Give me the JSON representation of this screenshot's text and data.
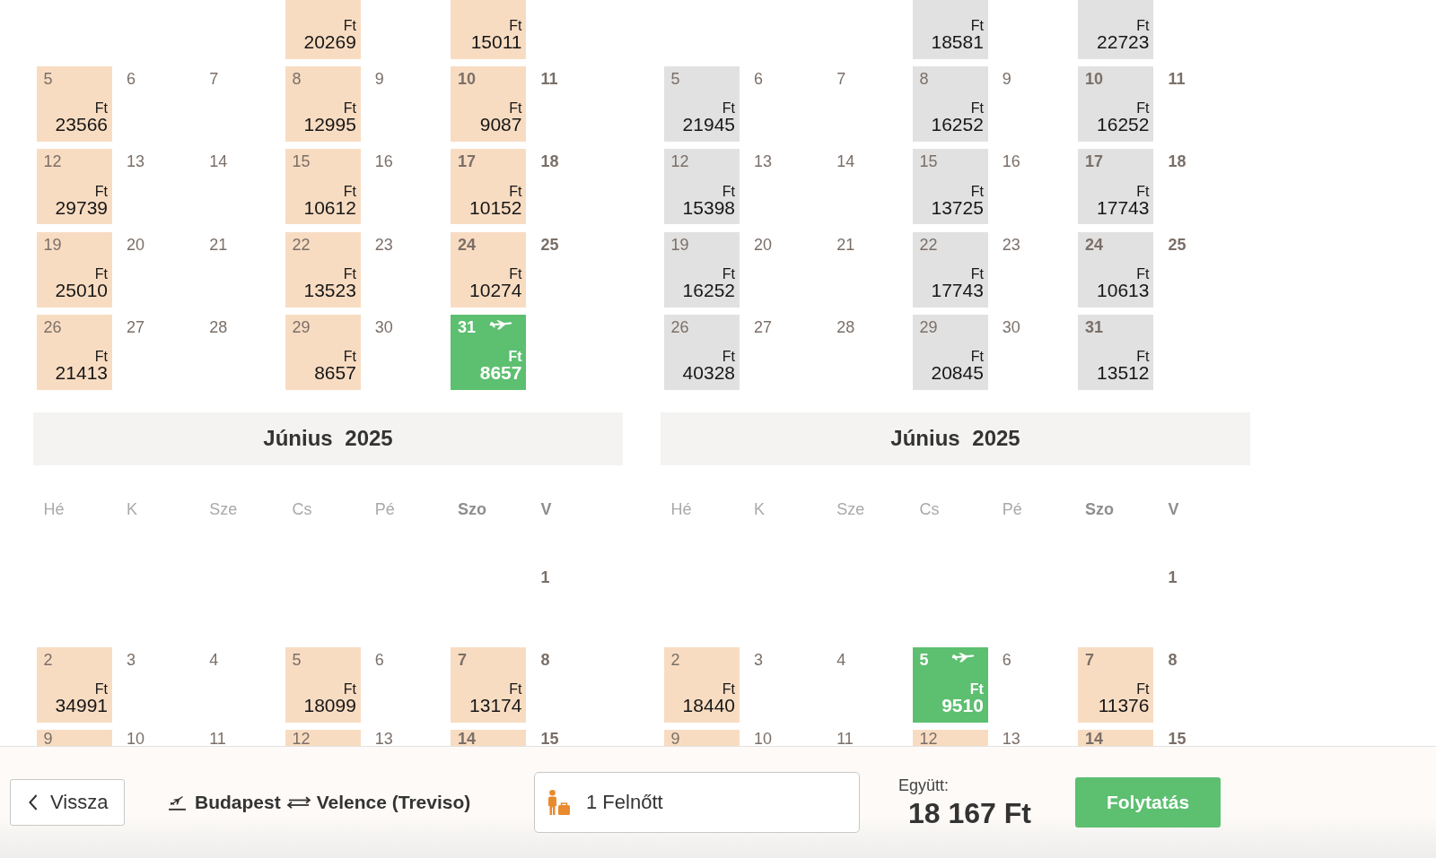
{
  "calendars": [
    {
      "months": [
        {
          "weeks": [
            [
              {
                "kind": "blank"
              },
              {
                "kind": "blank"
              },
              {
                "kind": "blank"
              },
              {
                "kind": "fare",
                "currency": "Ft",
                "price": "20269",
                "selected": false,
                "disabled": false
              },
              {
                "kind": "blank"
              },
              {
                "kind": "fare",
                "currency": "Ft",
                "price": "15011",
                "selected": false,
                "disabled": false
              },
              {
                "kind": "blank"
              }
            ],
            [
              {
                "kind": "fare",
                "day": "5",
                "currency": "Ft",
                "price": "23566",
                "selected": false,
                "disabled": false
              },
              {
                "kind": "plain",
                "day": "6"
              },
              {
                "kind": "plain",
                "day": "7"
              },
              {
                "kind": "fare",
                "day": "8",
                "currency": "Ft",
                "price": "12995",
                "selected": false,
                "disabled": false
              },
              {
                "kind": "plain",
                "day": "9"
              },
              {
                "kind": "fare",
                "day": "10",
                "currency": "Ft",
                "price": "9087",
                "selected": false,
                "disabled": false
              },
              {
                "kind": "plain",
                "day": "11"
              }
            ],
            [
              {
                "kind": "fare",
                "day": "12",
                "currency": "Ft",
                "price": "29739",
                "selected": false,
                "disabled": false
              },
              {
                "kind": "plain",
                "day": "13"
              },
              {
                "kind": "plain",
                "day": "14"
              },
              {
                "kind": "fare",
                "day": "15",
                "currency": "Ft",
                "price": "10612",
                "selected": false,
                "disabled": false
              },
              {
                "kind": "plain",
                "day": "16"
              },
              {
                "kind": "fare",
                "day": "17",
                "currency": "Ft",
                "price": "10152",
                "selected": false,
                "disabled": false
              },
              {
                "kind": "plain",
                "day": "18"
              }
            ],
            [
              {
                "kind": "fare",
                "day": "19",
                "currency": "Ft",
                "price": "25010",
                "selected": false,
                "disabled": false
              },
              {
                "kind": "plain",
                "day": "20"
              },
              {
                "kind": "plain",
                "day": "21"
              },
              {
                "kind": "fare",
                "day": "22",
                "currency": "Ft",
                "price": "13523",
                "selected": false,
                "disabled": false
              },
              {
                "kind": "plain",
                "day": "23"
              },
              {
                "kind": "fare",
                "day": "24",
                "currency": "Ft",
                "price": "10274",
                "selected": false,
                "disabled": false
              },
              {
                "kind": "plain",
                "day": "25"
              }
            ],
            [
              {
                "kind": "fare",
                "day": "26",
                "currency": "Ft",
                "price": "21413",
                "selected": false,
                "disabled": false
              },
              {
                "kind": "plain",
                "day": "27"
              },
              {
                "kind": "plain",
                "day": "28"
              },
              {
                "kind": "fare",
                "day": "29",
                "currency": "Ft",
                "price": "8657",
                "selected": false,
                "disabled": false
              },
              {
                "kind": "plain",
                "day": "30"
              },
              {
                "kind": "fare",
                "day": "31",
                "currency": "Ft",
                "price": "8657",
                "selected": true,
                "disabled": false
              },
              {
                "kind": "blank"
              }
            ]
          ]
        },
        {
          "title": "Június 2025",
          "weekdays": [
            "Hé",
            "K",
            "Sze",
            "Cs",
            "Pé",
            "Szo",
            "V"
          ],
          "weeks": [
            [
              {
                "kind": "blank"
              },
              {
                "kind": "blank"
              },
              {
                "kind": "blank"
              },
              {
                "kind": "blank"
              },
              {
                "kind": "blank"
              },
              {
                "kind": "blank"
              },
              {
                "kind": "plain",
                "day": "1"
              }
            ],
            [
              {
                "kind": "fare",
                "day": "2",
                "currency": "Ft",
                "price": "34991",
                "selected": false,
                "disabled": false
              },
              {
                "kind": "plain",
                "day": "3"
              },
              {
                "kind": "plain",
                "day": "4"
              },
              {
                "kind": "fare",
                "day": "5",
                "currency": "Ft",
                "price": "18099",
                "selected": false,
                "disabled": false
              },
              {
                "kind": "plain",
                "day": "6"
              },
              {
                "kind": "fare",
                "day": "7",
                "currency": "Ft",
                "price": "13174",
                "selected": false,
                "disabled": false
              },
              {
                "kind": "plain",
                "day": "8"
              }
            ],
            [
              {
                "kind": "fare",
                "day": "9",
                "selected": false,
                "disabled": false
              },
              {
                "kind": "plain",
                "day": "10"
              },
              {
                "kind": "plain",
                "day": "11"
              },
              {
                "kind": "fare",
                "day": "12",
                "selected": false,
                "disabled": false
              },
              {
                "kind": "plain",
                "day": "13"
              },
              {
                "kind": "fare",
                "day": "14",
                "selected": false,
                "disabled": false
              },
              {
                "kind": "plain",
                "day": "15"
              }
            ]
          ]
        }
      ]
    },
    {
      "months": [
        {
          "weeks": [
            [
              {
                "kind": "blank"
              },
              {
                "kind": "blank"
              },
              {
                "kind": "blank"
              },
              {
                "kind": "fare",
                "currency": "Ft",
                "price": "18581",
                "selected": false,
                "disabled": true
              },
              {
                "kind": "blank"
              },
              {
                "kind": "fare",
                "currency": "Ft",
                "price": "22723",
                "selected": false,
                "disabled": true
              },
              {
                "kind": "blank"
              }
            ],
            [
              {
                "kind": "fare",
                "day": "5",
                "currency": "Ft",
                "price": "21945",
                "selected": false,
                "disabled": true
              },
              {
                "kind": "plain",
                "day": "6"
              },
              {
                "kind": "plain",
                "day": "7"
              },
              {
                "kind": "fare",
                "day": "8",
                "currency": "Ft",
                "price": "16252",
                "selected": false,
                "disabled": true
              },
              {
                "kind": "plain",
                "day": "9"
              },
              {
                "kind": "fare",
                "day": "10",
                "currency": "Ft",
                "price": "16252",
                "selected": false,
                "disabled": true
              },
              {
                "kind": "plain",
                "day": "11"
              }
            ],
            [
              {
                "kind": "fare",
                "day": "12",
                "currency": "Ft",
                "price": "15398",
                "selected": false,
                "disabled": true
              },
              {
                "kind": "plain",
                "day": "13"
              },
              {
                "kind": "plain",
                "day": "14"
              },
              {
                "kind": "fare",
                "day": "15",
                "currency": "Ft",
                "price": "13725",
                "selected": false,
                "disabled": true
              },
              {
                "kind": "plain",
                "day": "16"
              },
              {
                "kind": "fare",
                "day": "17",
                "currency": "Ft",
                "price": "17743",
                "selected": false,
                "disabled": true
              },
              {
                "kind": "plain",
                "day": "18"
              }
            ],
            [
              {
                "kind": "fare",
                "day": "19",
                "currency": "Ft",
                "price": "16252",
                "selected": false,
                "disabled": true
              },
              {
                "kind": "plain",
                "day": "20"
              },
              {
                "kind": "plain",
                "day": "21"
              },
              {
                "kind": "fare",
                "day": "22",
                "currency": "Ft",
                "price": "17743",
                "selected": false,
                "disabled": true
              },
              {
                "kind": "plain",
                "day": "23"
              },
              {
                "kind": "fare",
                "day": "24",
                "currency": "Ft",
                "price": "10613",
                "selected": false,
                "disabled": true
              },
              {
                "kind": "plain",
                "day": "25"
              }
            ],
            [
              {
                "kind": "fare",
                "day": "26",
                "currency": "Ft",
                "price": "40328",
                "selected": false,
                "disabled": true
              },
              {
                "kind": "plain",
                "day": "27"
              },
              {
                "kind": "plain",
                "day": "28"
              },
              {
                "kind": "fare",
                "day": "29",
                "currency": "Ft",
                "price": "20845",
                "selected": false,
                "disabled": true
              },
              {
                "kind": "plain",
                "day": "30"
              },
              {
                "kind": "fare",
                "day": "31",
                "currency": "Ft",
                "price": "13512",
                "selected": false,
                "disabled": true
              },
              {
                "kind": "blank"
              }
            ]
          ]
        },
        {
          "title": "Június 2025",
          "weekdays": [
            "Hé",
            "K",
            "Sze",
            "Cs",
            "Pé",
            "Szo",
            "V"
          ],
          "weeks": [
            [
              {
                "kind": "blank"
              },
              {
                "kind": "blank"
              },
              {
                "kind": "blank"
              },
              {
                "kind": "blank"
              },
              {
                "kind": "blank"
              },
              {
                "kind": "blank"
              },
              {
                "kind": "plain",
                "day": "1"
              }
            ],
            [
              {
                "kind": "fare",
                "day": "2",
                "currency": "Ft",
                "price": "18440",
                "selected": false,
                "disabled": false
              },
              {
                "kind": "plain",
                "day": "3"
              },
              {
                "kind": "plain",
                "day": "4"
              },
              {
                "kind": "fare",
                "day": "5",
                "currency": "Ft",
                "price": "9510",
                "selected": true,
                "disabled": false
              },
              {
                "kind": "plain",
                "day": "6"
              },
              {
                "kind": "fare",
                "day": "7",
                "currency": "Ft",
                "price": "11376",
                "selected": false,
                "disabled": false
              },
              {
                "kind": "plain",
                "day": "8"
              }
            ],
            [
              {
                "kind": "fare",
                "day": "9",
                "selected": false,
                "disabled": false
              },
              {
                "kind": "plain",
                "day": "10"
              },
              {
                "kind": "plain",
                "day": "11"
              },
              {
                "kind": "fare",
                "day": "12",
                "selected": false,
                "disabled": false
              },
              {
                "kind": "plain",
                "day": "13"
              },
              {
                "kind": "fare",
                "day": "14",
                "selected": false,
                "disabled": false
              },
              {
                "kind": "plain",
                "day": "15"
              }
            ]
          ]
        }
      ]
    }
  ],
  "booking_bar": {
    "back_button": {
      "label": "Vissza"
    },
    "route": {
      "origin": "Budapest",
      "destination": "Velence (Treviso)"
    },
    "passengers": {
      "value": "1 Felnőtt"
    },
    "total": {
      "label": "Együtt:",
      "amount": "18 167 Ft"
    },
    "continue_button": {
      "label": "Folytatás"
    }
  }
}
